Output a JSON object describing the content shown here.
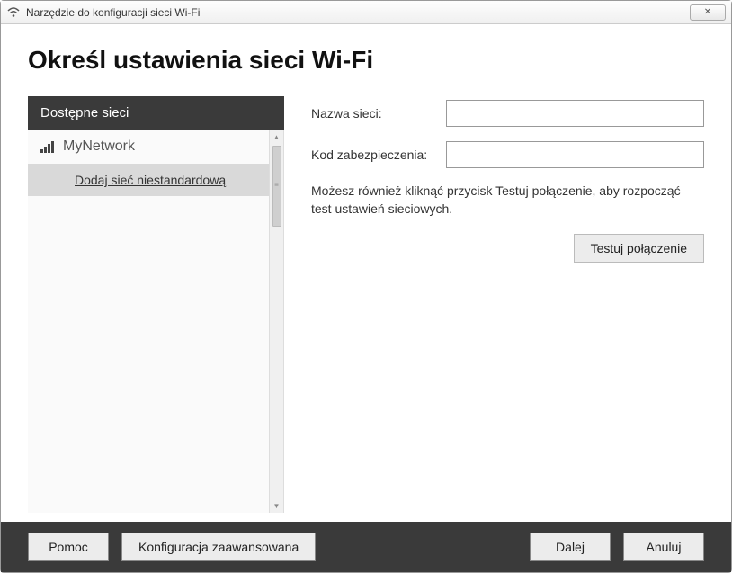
{
  "titlebar": {
    "title": "Narzędzie do konfiguracji sieci Wi-Fi"
  },
  "page": {
    "heading": "Określ ustawienia sieci Wi-Fi"
  },
  "sidebar": {
    "header": "Dostępne sieci",
    "networks": [
      {
        "name": "MyNetwork"
      }
    ],
    "add_custom": "Dodaj sieć niestandardową"
  },
  "form": {
    "network_name_label": "Nazwa sieci:",
    "network_name_value": "",
    "security_code_label": "Kod zabezpieczenia:",
    "security_code_value": "",
    "hint": "Możesz również kliknąć przycisk Testuj połączenie, aby rozpocząć test ustawień sieciowych.",
    "test_button": "Testuj połączenie"
  },
  "footer": {
    "help": "Pomoc",
    "advanced": "Konfiguracja zaawansowana",
    "next": "Dalej",
    "cancel": "Anuluj"
  }
}
